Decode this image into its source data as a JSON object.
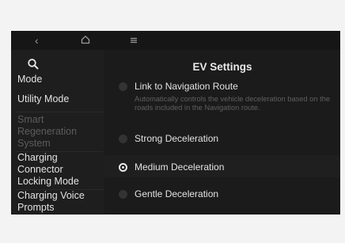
{
  "nav": {
    "back_icon": "chevron-left-icon",
    "home_icon": "home-icon",
    "menu_icon": "menu-icon"
  },
  "sidebar": {
    "search_icon": "search-icon",
    "items": [
      {
        "label": "Mode",
        "state": "normal"
      },
      {
        "label": "Utility Mode",
        "state": "normal"
      },
      {
        "label": "Smart Regeneration System",
        "state": "disabled"
      },
      {
        "label": "Charging Connector Locking Mode",
        "state": "normal"
      },
      {
        "label": "Charging Voice Prompts",
        "state": "normal"
      }
    ]
  },
  "main": {
    "title": "EV Settings",
    "options": [
      {
        "label": "Link to Navigation Route",
        "description": "Automatically controls the vehicle deceleration based on the roads included in the Navigation route.",
        "selected": false
      },
      {
        "label": "Strong Deceleration",
        "selected": false
      },
      {
        "label": "Medium Deceleration",
        "selected": true
      },
      {
        "label": "Gentle Deceleration",
        "selected": false
      }
    ]
  },
  "colors": {
    "screen_bg": "#1b1b1b",
    "text": "#e2e2e2",
    "disabled_text": "#5c5c5c"
  }
}
